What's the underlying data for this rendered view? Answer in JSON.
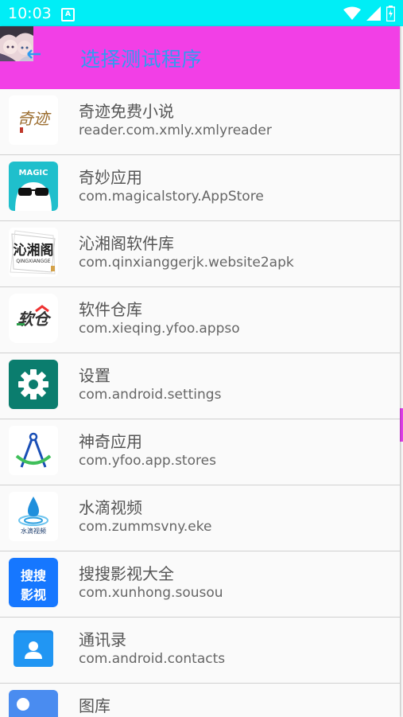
{
  "status_bar": {
    "time": "10:03",
    "notification_icon": "a-box-icon",
    "icons": [
      "wifi-icon",
      "signal-icon",
      "battery-icon"
    ]
  },
  "dialog": {
    "title": "选择测试程序",
    "back_icon": "back-arrow-icon",
    "title_color": "#2f9bf0",
    "titlebar_color": "#f23fe6"
  },
  "apps": [
    {
      "name": "奇迹免费小说",
      "package": "reader.com.xmly.xmlyreader",
      "icon": "qiji-novel-icon"
    },
    {
      "name": "奇妙应用",
      "package": "com.magicalstory.AppStore",
      "icon": "magic-app-icon"
    },
    {
      "name": "沁湘阁软件库",
      "package": "com.qinxianggerjk.website2apk",
      "icon": "qinxiangge-icon"
    },
    {
      "name": "软件仓库",
      "package": "com.xieqing.yfoo.appso",
      "icon": "software-repo-icon"
    },
    {
      "name": "设置",
      "package": "com.android.settings",
      "icon": "settings-gear-icon"
    },
    {
      "name": "神奇应用",
      "package": "com.yfoo.app.stores",
      "icon": "compass-icon"
    },
    {
      "name": "水滴视频",
      "package": "com.zummsvny.eke",
      "icon": "water-drop-icon"
    },
    {
      "name": "搜搜影视大全",
      "package": "com.xunhong.sousou",
      "icon": "sousou-icon"
    },
    {
      "name": "通讯录",
      "package": "com.android.contacts",
      "icon": "contacts-icon"
    },
    {
      "name": "图库",
      "package": "",
      "icon": "gallery-icon"
    }
  ]
}
